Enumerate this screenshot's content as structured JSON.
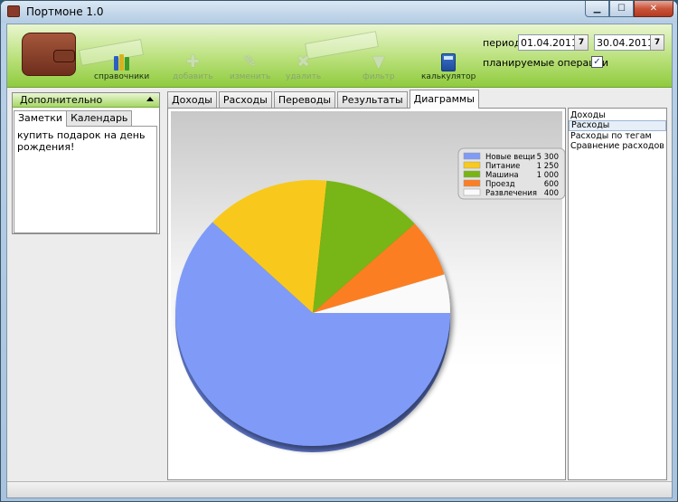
{
  "window": {
    "title": "Портмоне 1.0"
  },
  "toolbar": {
    "directories_label": "справочники",
    "add_label": "добавить",
    "edit_label": "изменить",
    "delete_label": "удалить",
    "filter_label": "фильтр",
    "calculator_label": "калькулятор"
  },
  "period": {
    "label": "период",
    "from": "01.04.2011",
    "to": "30.04.2011",
    "calendar_glyph": "7"
  },
  "planned": {
    "label": "планируемые операции",
    "checked": true
  },
  "left_panel": {
    "header": "Дополнительно",
    "tabs": [
      "Заметки",
      "Календарь"
    ],
    "notes_text": "купить подарок на день рождения!"
  },
  "main_tabs": [
    "Доходы",
    "Расходы",
    "Переводы",
    "Результаты",
    "Диаграммы"
  ],
  "right_list": [
    "Доходы",
    "Расходы",
    "Расходы по тегам",
    "Сравнение расходов"
  ],
  "colors": {
    "slice1": "#7f9bf7",
    "slice2": "#f8c91e",
    "slice3": "#78b512",
    "slice4": "#fb7f22",
    "slice5": "#fafafa"
  },
  "chart_data": {
    "type": "pie",
    "categories": [
      "Новые вещи",
      "Питание",
      "Машина",
      "Проезд",
      "Развлечения"
    ],
    "values": [
      5300,
      1250,
      1000,
      600,
      400
    ],
    "value_labels": [
      "5 300",
      "1 250",
      "1 000",
      "600",
      "400"
    ],
    "legend": "top-right"
  }
}
